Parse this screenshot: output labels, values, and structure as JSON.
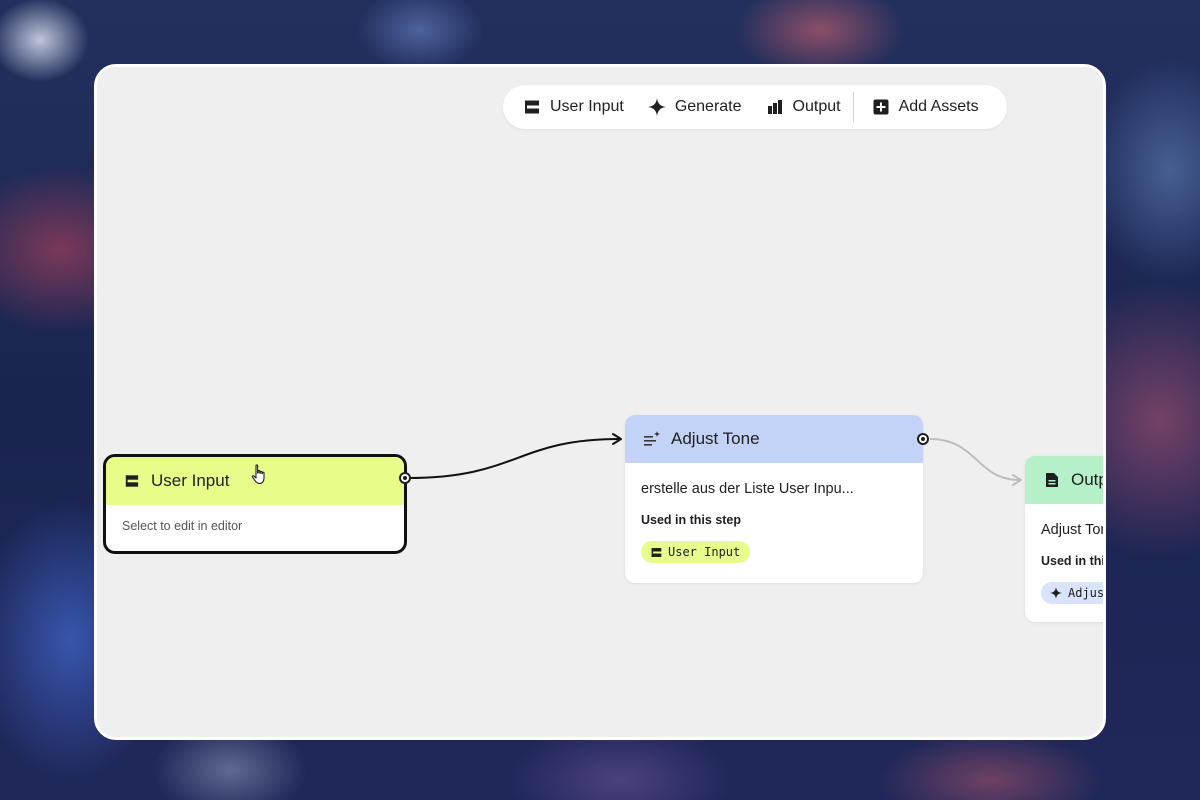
{
  "toolbar": {
    "items": [
      {
        "label": "User Input",
        "icon": "flag-icon"
      },
      {
        "label": "Generate",
        "icon": "sparkle-icon"
      },
      {
        "label": "Output",
        "icon": "bar-chart-icon"
      }
    ],
    "add_assets": {
      "label": "Add Assets",
      "icon": "plus-box-icon"
    }
  },
  "nodes": {
    "user_input": {
      "title": "User Input",
      "subtitle": "Select to edit in editor",
      "header_color": "#e8fc8a"
    },
    "adjust_tone": {
      "title": "Adjust Tone",
      "description": "erstelle aus der Liste User Inpu...",
      "used_label": "Used in this step",
      "chip": "User Input",
      "header_color": "#c3d3f7"
    },
    "output": {
      "title": "Outp",
      "description": "Adjust Ton",
      "used_label": "Used in thi",
      "chip": "Adjus",
      "header_color": "#b6f0c9"
    }
  },
  "colors": {
    "canvas": "#efefef",
    "wire_active": "#111111",
    "wire_inactive": "#bdbdbd"
  }
}
